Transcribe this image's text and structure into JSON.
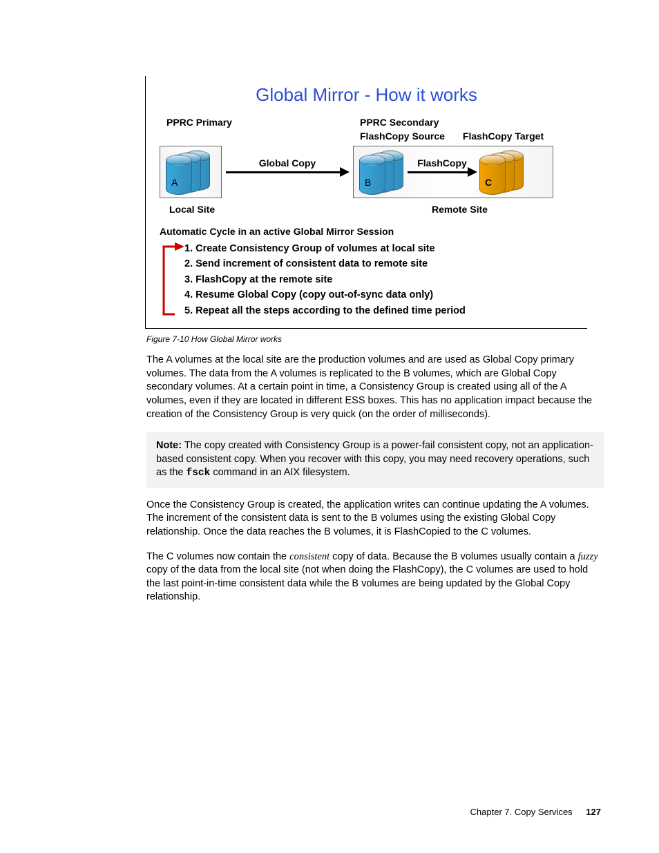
{
  "figure": {
    "title": "Global Mirror - How it works",
    "labels": {
      "pprc_primary": "PPRC Primary",
      "pprc_secondary": "PPRC Secondary",
      "fc_source": "FlashCopy Source",
      "fc_target": "FlashCopy Target",
      "global_copy_arrow": "Global Copy",
      "flashcopy_arrow": "FlashCopy",
      "cyl_a": "A",
      "cyl_b": "B",
      "cyl_c": "C",
      "local_site": "Local Site",
      "remote_site": "Remote Site"
    },
    "cycle_heading": "Automatic Cycle in an active Global Mirror Session",
    "steps": [
      "1. Create Consistency Group of volumes at local site",
      "2. Send increment of consistent data to remote site",
      "3. FlashCopy at the remote site",
      "4. Resume Global Copy (copy out-of-sync data only)",
      "5. Repeat all the steps according to the defined time period"
    ],
    "caption": "Figure 7-10   How Global Mirror works"
  },
  "paragraphs": {
    "p1": "The A volumes at the local site are the production volumes and are used as Global Copy primary volumes. The data from the A volumes is replicated to the B volumes, which are Global Copy secondary volumes. At a certain point in time, a Consistency Group is created using all of the A volumes, even if they are located in different ESS boxes. This has no application impact because the creation of the Consistency Group is very quick (on the order of milliseconds).",
    "note_label": "Note:",
    "note_before": " The copy created with Consistency Group is a power-fail consistent copy, not an application-based consistent copy. When you recover with this copy, you may need recovery operations, such as the ",
    "note_cmd": "fsck",
    "note_after": " command in an AIX filesystem.",
    "p2": "Once the Consistency Group is created, the application writes can continue updating the A volumes. The increment of the consistent data is sent to the B volumes using the existing Global Copy relationship. Once the data reaches the B volumes, it is FlashCopied to the C volumes.",
    "p3_a": "The C volumes now contain the ",
    "p3_consistent": "consistent",
    "p3_b": " copy of data. Because the B volumes usually contain a ",
    "p3_fuzzy": "fuzzy",
    "p3_c": " copy of the data from the local site (not when doing the FlashCopy), the C volumes are used to hold the last point-in-time consistent data while the B volumes are being updated by the Global Copy relationship."
  },
  "footer": {
    "chapter": "Chapter 7. Copy Services",
    "page": "127"
  }
}
